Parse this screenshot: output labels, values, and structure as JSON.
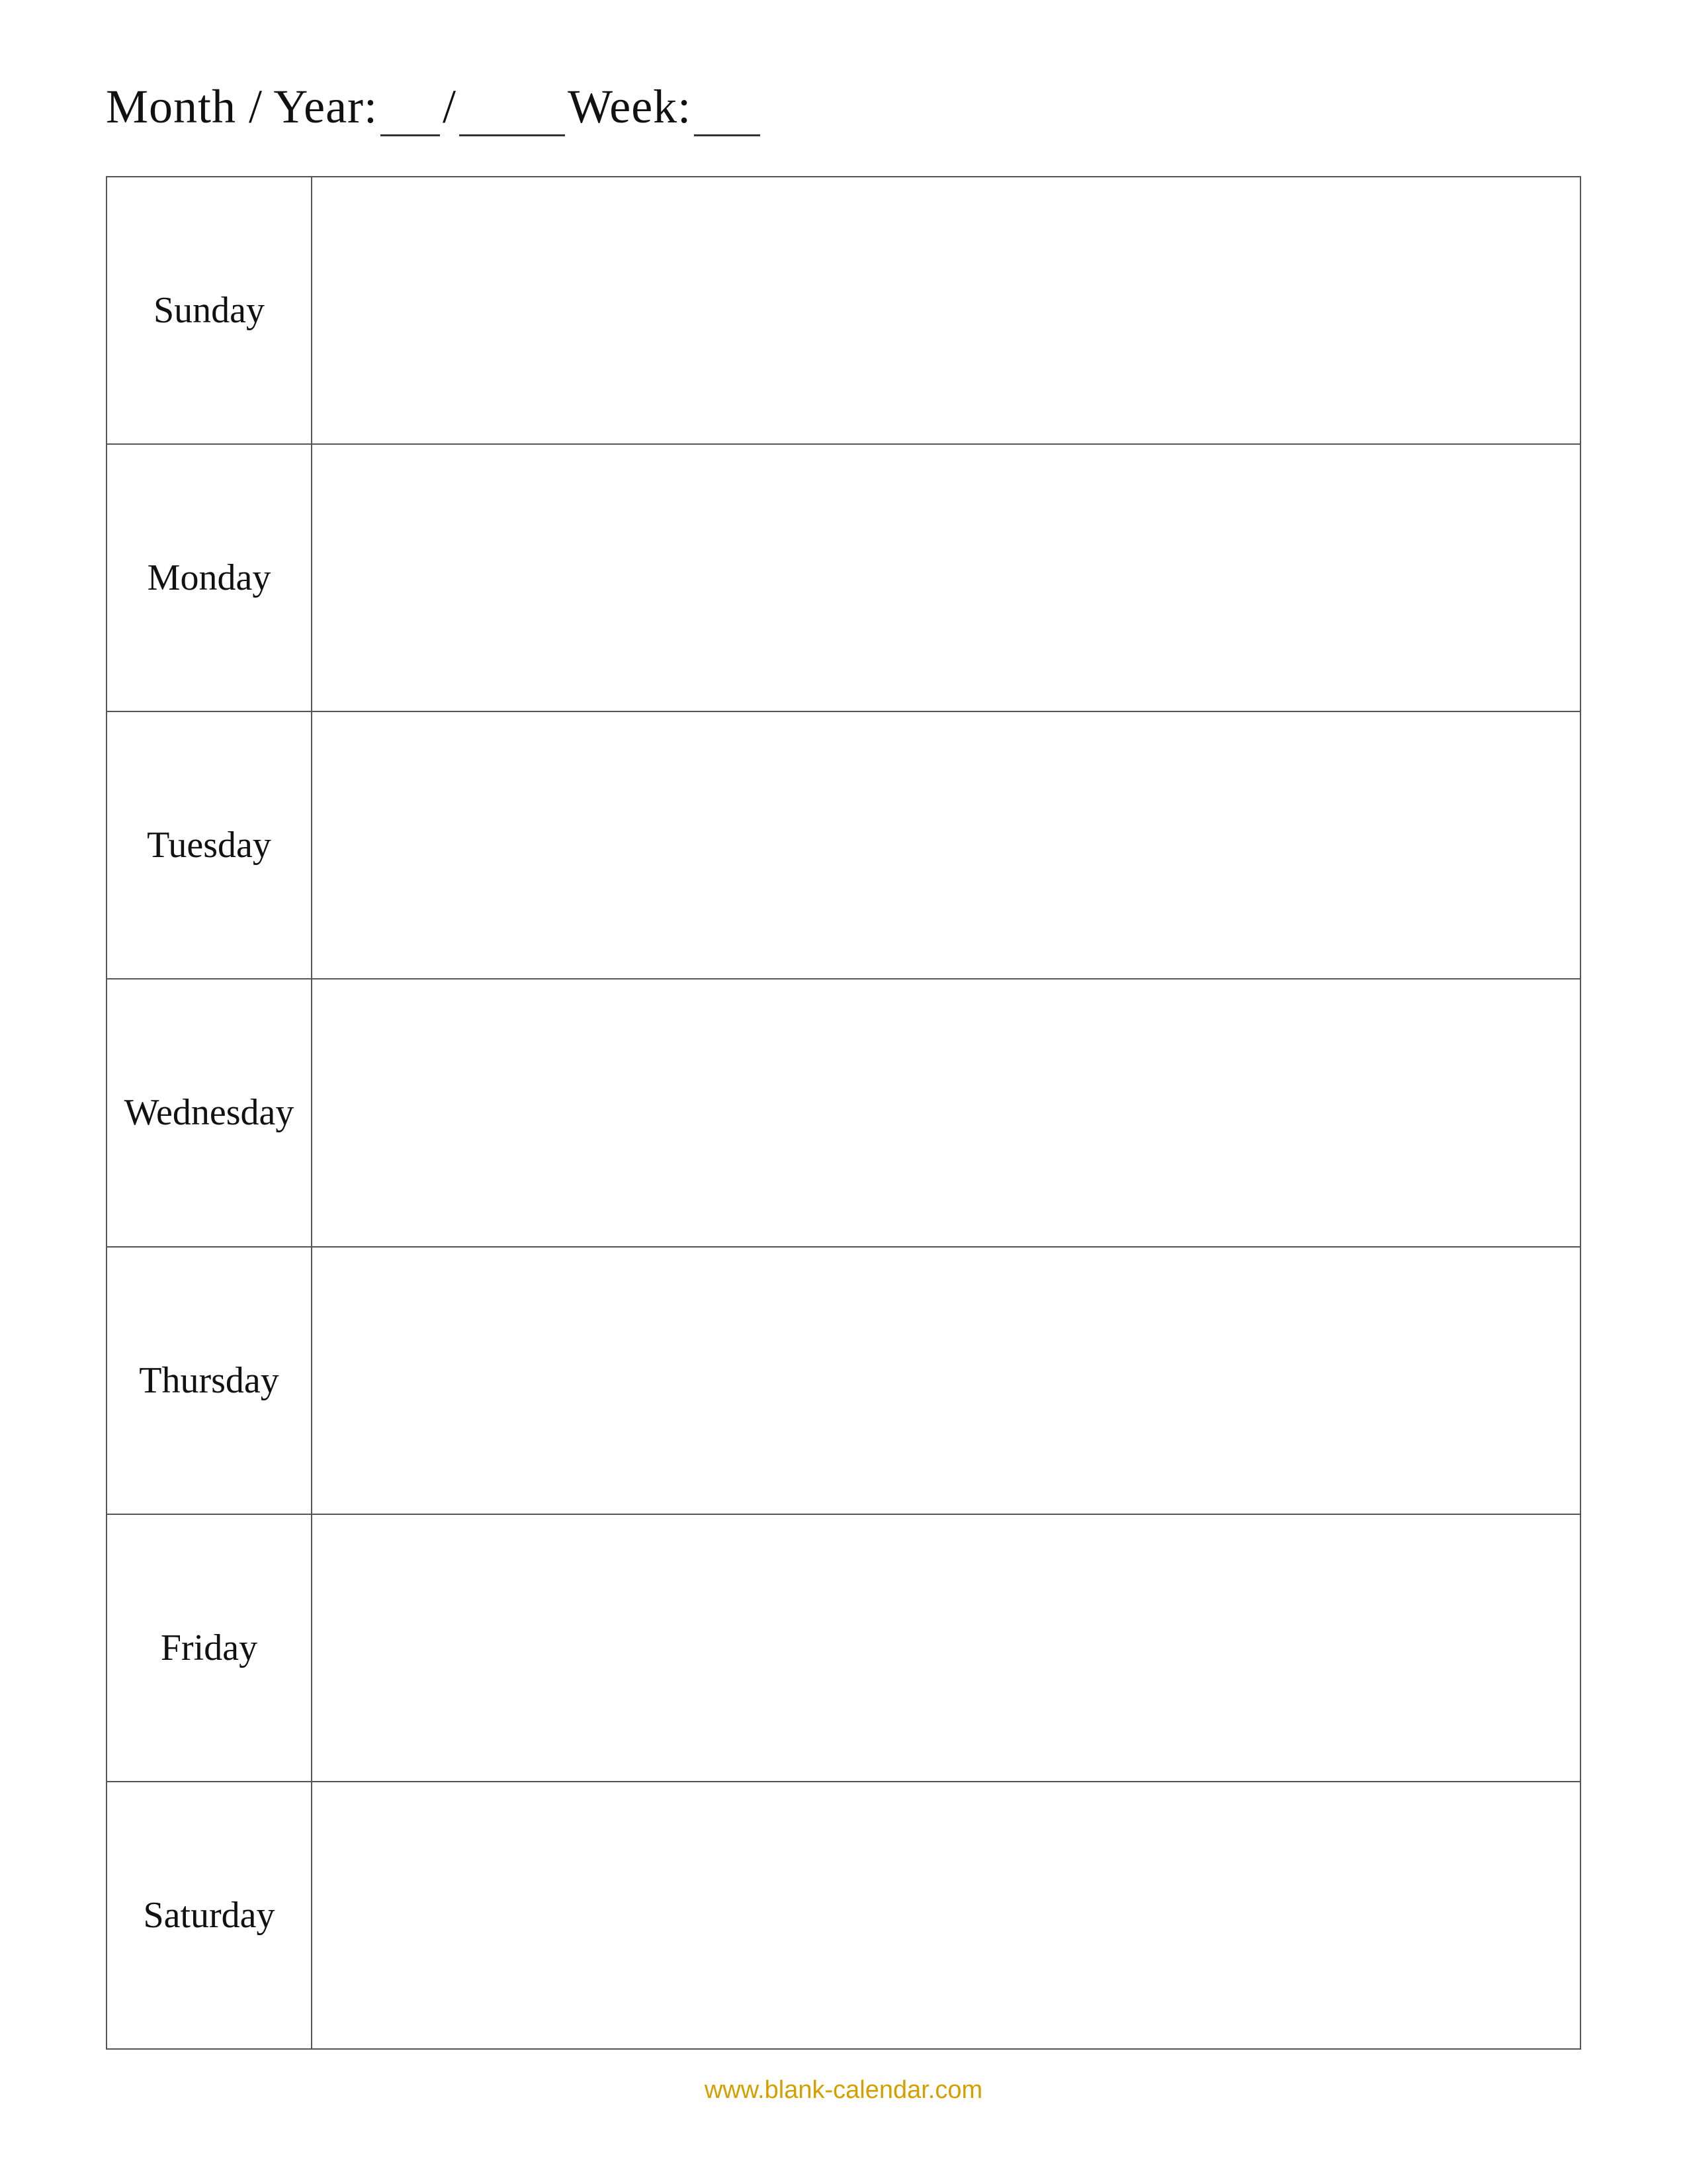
{
  "header": {
    "month_year_label": "Month / Year: ",
    "month_blank1": "_ _",
    "separator": " / ",
    "year_blank": "_ _ _ _",
    "week_label": "  Week: ",
    "week_blank": "_ _"
  },
  "days": [
    {
      "name": "Sunday"
    },
    {
      "name": "Monday"
    },
    {
      "name": "Tuesday"
    },
    {
      "name": "Wednesday"
    },
    {
      "name": "Thursday"
    },
    {
      "name": "Friday"
    },
    {
      "name": "Saturday"
    }
  ],
  "footer": {
    "url": "www.blank-calendar.com"
  }
}
